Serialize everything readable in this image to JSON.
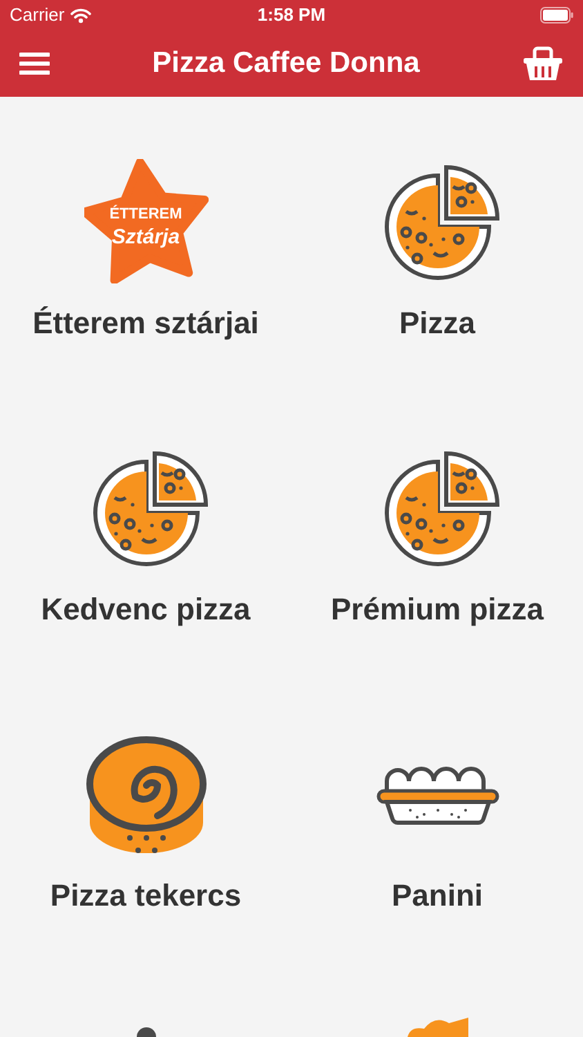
{
  "status_bar": {
    "carrier": "Carrier",
    "time": "1:58 PM"
  },
  "nav": {
    "title": "Pizza Caffee Donna"
  },
  "categories": [
    {
      "kind": "star",
      "badge_top": "ÉTTEREM",
      "badge_bottom": "Sztárja",
      "label": "Étterem sztárjai"
    },
    {
      "kind": "pizza",
      "label": "Pizza"
    },
    {
      "kind": "pizza",
      "label": "Kedvenc pizza"
    },
    {
      "kind": "pizza",
      "label": "Prémium pizza"
    },
    {
      "kind": "roll",
      "label": "Pizza tekercs"
    },
    {
      "kind": "sandwich",
      "label": "Panini"
    },
    {
      "kind": "dark-partial"
    },
    {
      "kind": "orange-partial"
    }
  ]
}
